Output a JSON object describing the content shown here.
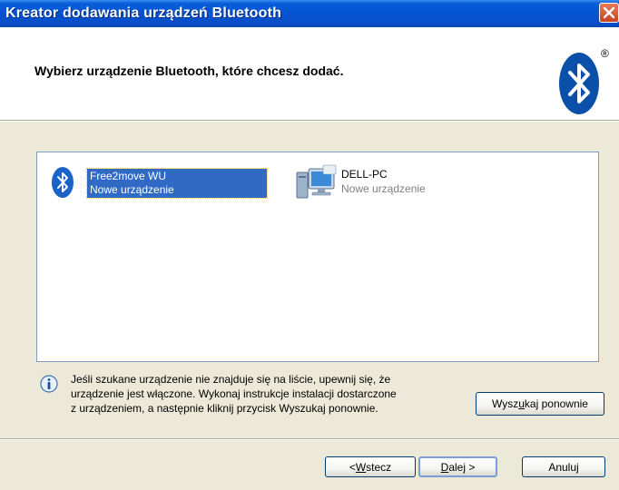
{
  "window": {
    "title": "Kreator dodawania urządzeń Bluetooth"
  },
  "header": {
    "title": "Wybierz urządzenie Bluetooth, które chcesz dodać.",
    "logo_mark": "®"
  },
  "devices": [
    {
      "name": "Free2move WU",
      "status": "Nowe urządzenie",
      "icon": "bluetooth-device-icon",
      "selected": true
    },
    {
      "name": "DELL-PC",
      "status": "Nowe urządzenie",
      "icon": "computer-icon",
      "selected": false
    }
  ],
  "info": {
    "lines": [
      "Jeśli szukane urządzenie nie znajduje się na liście, upewnij się, że",
      "urządzenie jest włączone. Wykonaj instrukcje instalacji dostarczone",
      "z urządzeniem, a następnie kliknij przycisk Wyszukaj ponownie."
    ]
  },
  "buttons": {
    "search_again": {
      "pre": "Wysz",
      "access": "u",
      "post": "kaj ponownie"
    },
    "back": {
      "pre": "< ",
      "access": "W",
      "post": "stecz"
    },
    "next": {
      "pre": "",
      "access": "D",
      "post": "alej >"
    },
    "cancel": "Anuluj"
  },
  "colors": {
    "title_bar": "#0551d1",
    "selection": "#316ac5",
    "dialog_bg": "#ece9d8",
    "bluetooth_blue": "#0a4fa8"
  }
}
